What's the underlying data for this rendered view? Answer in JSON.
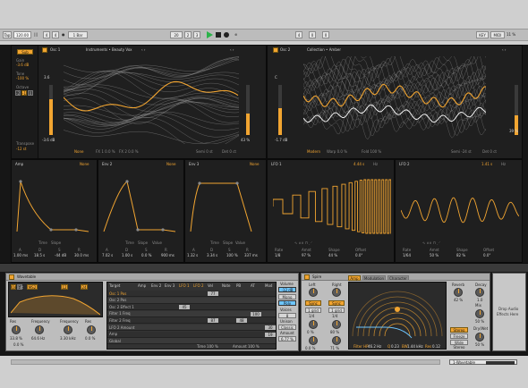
{
  "transport": {
    "tap": "Tap",
    "tempo": "120.00",
    "ts_num": "4",
    "ts_den": "4",
    "bar": "1 Bar",
    "pos1": "20",
    "pos2": "2",
    "pos3": "3",
    "end1": "4",
    "end2": "0",
    "end3": "0",
    "key": "KEY",
    "midi": "MIDI",
    "cpu": "11 %"
  },
  "osc1": {
    "mode_btn": "Sub",
    "gain_label": "Gain",
    "gain": "-3.6 dB",
    "tone_label": "Tone",
    "tone": "-100 %",
    "octave_label": "Octave",
    "oct_opts": [
      "-2",
      "-1",
      "0"
    ],
    "transpose_label": "Transpose",
    "transpose": "-12 st",
    "title": "Osc 1",
    "wavetable": "Instruments • Beauty Vox",
    "level_label": "3.6",
    "level_db": "-3.6 dB",
    "fx_mode": "None",
    "fx1": "FX 1  0.0 %",
    "fx2": "FX 2  0.0 %",
    "semi": "Semi  0 st",
    "det": "Det  0 ct",
    "pos_pct": "43 %"
  },
  "osc2": {
    "title": "Osc 2",
    "wavetable": "Collection • Amber",
    "level_db": "-1.7 dB",
    "fx_mode": "Modern",
    "warp": "Warp  0.0 %",
    "fold": "Fold  100 %",
    "semi": "Semi  -24 st",
    "det": "Det  0 ct",
    "pos_pct": "39 %"
  },
  "env": [
    {
      "title": "Amp",
      "mode": "None",
      "a": "1.00 ms",
      "d": "18.5 s",
      "s": "-44 dB",
      "r": "30.0 ms",
      "ticks": [
        "A",
        "D",
        "S",
        "R"
      ]
    },
    {
      "title": "Env 2",
      "mode": "None",
      "a": "7.02 s",
      "d": "1.00 s",
      "s": "0.0 %",
      "r": "900 ms",
      "ticks": [
        "A",
        "D",
        "S",
        "R"
      ]
    },
    {
      "title": "Env 3",
      "mode": "None",
      "a": "1.32 s",
      "d": "3.34 s",
      "s": "100 %",
      "r": "337 ms",
      "ticks": [
        "A",
        "D",
        "S",
        "R"
      ]
    }
  ],
  "env_footer": {
    "time": "Time",
    "slope": "Slope",
    "value": "Value"
  },
  "lfo": [
    {
      "title": "LFO 1",
      "rate": "4.44 s",
      "hz": "Hz",
      "labels": [
        "Rate",
        "Amnt",
        "Shape",
        "Offset"
      ],
      "values": [
        "1/8",
        "97 %",
        "44 %",
        "0.0°"
      ]
    },
    {
      "title": "LFO 2",
      "rate": "1.41 s",
      "hz": "Hz",
      "labels": [
        "Rate",
        "Amnt",
        "Shape",
        "Offset"
      ],
      "values": [
        "1/64",
        "50 %",
        "82 %",
        "0.0°"
      ]
    }
  ],
  "device1": {
    "title": "Wavetable",
    "osc_tabs": [
      "Osc",
      "Filt",
      "Mod"
    ],
    "filter_btns": [
      "MS2",
      "12",
      "24"
    ],
    "res_label": "Res",
    "res": "33.8 %",
    "freq_label": "Frequency",
    "freq": "64.6 Hz",
    "res2": "0.0 %",
    "freq2_label": "Frequency",
    "freq2": "3.30 kHz",
    "res3_label": "Res",
    "res3": "0.0 %"
  },
  "matrix": {
    "cols": [
      "Amp",
      "Env 2",
      "Env 3",
      "LFO 1",
      "LFO 2",
      "Vel",
      "Note",
      "PB",
      "AT",
      "Mod"
    ],
    "target": "Target",
    "rows": [
      "Osc 1 Pos",
      "Osc 2 Pos",
      "Osc 2 Effect 1",
      "Filter 1 Freq",
      "Filter 2 Freq",
      "LFO 2 Amount",
      "Amp",
      "Global"
    ],
    "cells": [
      "77",
      "45",
      "100",
      "48",
      "87",
      "30",
      "19"
    ],
    "time_label": "Time",
    "time": "100 %",
    "amount_label": "Amount",
    "amount": "100 %"
  },
  "volume": {
    "label": "Volume",
    "value": "-12 dB",
    "mono": "Mono",
    "poly": "Poly",
    "voices_label": "Voices",
    "voices": "8",
    "glide_label": "Glide",
    "glide": "0.0 ms",
    "unison_label": "Unison",
    "unison": "Classic",
    "amount_label": "Amount",
    "amount": "6.77 %"
  },
  "device2": {
    "title": "Spire",
    "gain_left": "Left",
    "gain_right": "Right",
    "sync": "Sync",
    "sync2": "Sync",
    "rate1": "1/4",
    "rate2": "1/4",
    "rate_mode": "1 grid",
    "rate_mode2": "1 grid",
    "k1": "0 %",
    "k2": "80 %",
    "k3": "0.0 %",
    "k4": "71 %",
    "tabs": [
      "Amp",
      "Modulation",
      "Character"
    ],
    "filter_label": "Filter HP",
    "filter_freq": "46.2 Hz",
    "q_label": "Q",
    "q": "0.23",
    "bw_label": "BW",
    "bw": "1.44 kHz",
    "res_label": "Res",
    "res": "0.12",
    "reverb": "Reverb",
    "reverb_val": "42 %",
    "decay": "Decay",
    "decay_val": "1.0",
    "mix": "Mix",
    "mix_val": "50 %",
    "stereo": "Stereo",
    "freeze": "Freeze",
    "stereo_val": "Wide Stereo",
    "dw": "Dry/Wet",
    "dw_val": "50 %"
  },
  "drop": {
    "line1": "Drop Audio",
    "line2": "Effects Here"
  },
  "status_bar": {
    "track": "1-Wavetable"
  }
}
